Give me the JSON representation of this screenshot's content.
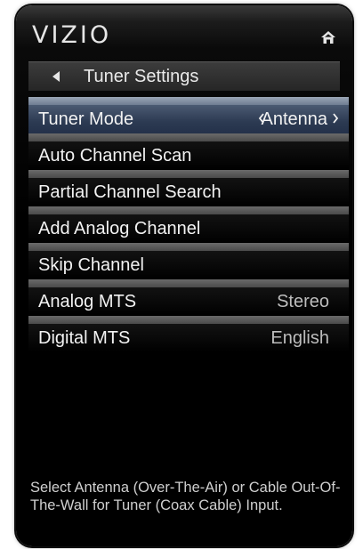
{
  "brand": {
    "logo_text": "VIZIO"
  },
  "icons": {
    "home": "home-icon",
    "back": "back-triangle-icon",
    "value_left": "chevron-left-icon",
    "value_right": "chevron-right-icon"
  },
  "header": {
    "title": "Tuner Settings"
  },
  "menu": {
    "items": [
      {
        "label": "Tuner Mode",
        "value": "Antenna",
        "selected": true
      },
      {
        "label": "Auto Channel Scan",
        "value": ""
      },
      {
        "label": "Partial Channel Search",
        "value": ""
      },
      {
        "label": "Add Analog Channel",
        "value": ""
      },
      {
        "label": "Skip Channel",
        "value": ""
      },
      {
        "label": "Analog MTS",
        "value": "Stereo"
      },
      {
        "label": "Digital MTS",
        "value": "English"
      }
    ]
  },
  "help": {
    "text": "Select Antenna (Over-The-Air) or Cable Out-Of-The-Wall for Tuner (Coax Cable) Input."
  },
  "colors": {
    "selected_band": "#2c3a52",
    "separator": "#5a5a5a",
    "background": "#000000",
    "text": "#f2f2f2",
    "value_text": "#bdbdbd"
  }
}
